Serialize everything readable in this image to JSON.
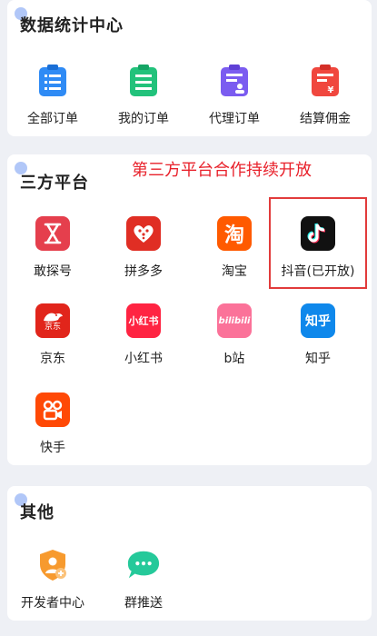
{
  "sections": {
    "data_stats": {
      "title": "数据统计中心",
      "items": [
        {
          "label": "全部订单",
          "icon": "order-list-icon"
        },
        {
          "label": "我的订单",
          "icon": "my-order-icon"
        },
        {
          "label": "代理订单",
          "icon": "agent-order-icon"
        },
        {
          "label": "结算佣金",
          "icon": "commission-icon"
        }
      ]
    },
    "third_party": {
      "title": "三方平台",
      "promo": "第三方平台合作持续开放",
      "items": [
        {
          "label": "敢探号",
          "icon": "gantanhao-icon"
        },
        {
          "label": "拼多多",
          "icon": "pinduoduo-icon"
        },
        {
          "label": "淘宝",
          "icon": "taobao-icon",
          "glyph": "淘"
        },
        {
          "label": "抖音(已开放)",
          "icon": "douyin-icon"
        },
        {
          "label": "京东",
          "icon": "jd-icon",
          "glyph": "京东"
        },
        {
          "label": "小红书",
          "icon": "xiaohongshu-icon",
          "glyph": "小红书"
        },
        {
          "label": "b站",
          "icon": "bilibili-icon",
          "glyph": "bilibili"
        },
        {
          "label": "知乎",
          "icon": "zhihu-icon",
          "glyph": "知乎"
        },
        {
          "label": "快手",
          "icon": "kuaishou-icon"
        }
      ]
    },
    "others": {
      "title": "其他",
      "items": [
        {
          "label": "开发者中心",
          "icon": "developer-shield-icon"
        },
        {
          "label": "群推送",
          "icon": "chat-bubble-icon"
        }
      ]
    }
  },
  "colors": {
    "accent_red": "#e8202a",
    "highlight_border": "#e23b3b",
    "page_bg": "#eef0f5"
  }
}
